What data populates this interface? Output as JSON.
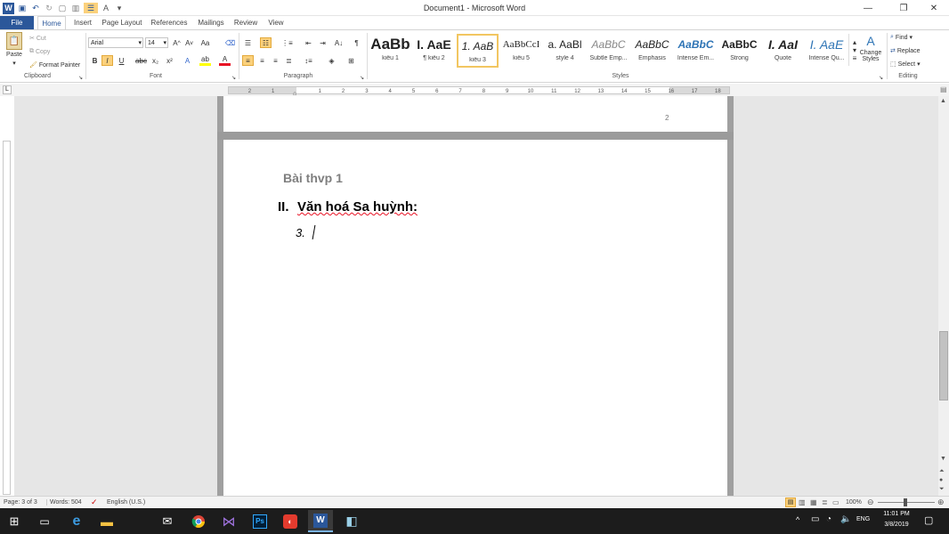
{
  "window": {
    "title": "Document1 - Microsoft Word",
    "controls": [
      "—",
      "❐",
      "✕"
    ]
  },
  "tabs": [
    "File",
    "Home",
    "Insert",
    "Page Layout",
    "References",
    "Mailings",
    "Review",
    "View"
  ],
  "ribbon": {
    "clipboard": {
      "paste": "Paste",
      "cut": "Cut",
      "copy": "Copy",
      "format_painter": "Format Painter",
      "label": "Clipboard"
    },
    "font": {
      "name": "Arial",
      "size": "14",
      "label": "Font"
    },
    "paragraph": {
      "label": "Paragraph"
    },
    "styles": {
      "label": "Styles",
      "items": [
        {
          "preview": "AaBb",
          "name": "kiểu 1"
        },
        {
          "preview": "I.  AaE",
          "name": "¶ kiểu 2"
        },
        {
          "preview": "1.  AaB",
          "name": "kiểu 3"
        },
        {
          "preview": "AaBbCcI",
          "name": "kiểu 5"
        },
        {
          "preview": "a.  AaBl",
          "name": "style 4"
        },
        {
          "preview": "AaBbC",
          "name": "Subtle Emp..."
        },
        {
          "preview": "AaBbC",
          "name": "Emphasis"
        },
        {
          "preview": "AaBbC",
          "name": "Intense Em..."
        },
        {
          "preview": "AaBbC",
          "name": "Strong"
        },
        {
          "preview": "I.  AaI",
          "name": "Quote"
        },
        {
          "preview": "I.  AaE",
          "name": "Intense Qu..."
        }
      ],
      "change_styles": "Change Styles"
    },
    "editing": {
      "find": "Find",
      "replace": "Replace",
      "select": "Select",
      "label": "Editing"
    }
  },
  "document": {
    "prev_page_number": "2",
    "title": "Bài thvp 1",
    "heading_num": "II.",
    "heading_text": "Văn hoá Sa huỳnh:",
    "list_num": "3."
  },
  "status": {
    "page": "Page: 3 of 3",
    "words": "Words: 504",
    "language": "English (U.S.)",
    "zoom": "100%"
  },
  "taskbar": {
    "lang": "ENG",
    "time": "11:01 PM",
    "date": "3/8/2019"
  },
  "colors": {
    "accent": "#2b579a",
    "spell_error": "#e81123"
  }
}
